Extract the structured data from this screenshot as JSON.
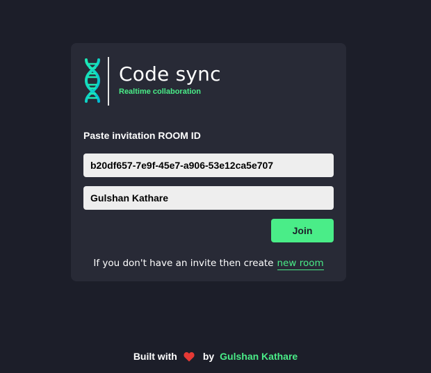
{
  "brand": {
    "title": "Code sync",
    "subtitle": "Realtime collaboration",
    "logo_icon": "dna-icon",
    "accent_color": "#4aed88"
  },
  "form": {
    "label": "Paste invitation ROOM ID",
    "room_id_value": "b20df657-7e9f-45e7-a906-53e12ca5e707",
    "username_value": "Gulshan Kathare",
    "join_label": "Join"
  },
  "create_info": {
    "text": "If you don't have an invite then create",
    "link_label": "new room"
  },
  "footer": {
    "built_with": "Built with",
    "heart_icon": "heart-icon",
    "by": "by",
    "author": "Gulshan Kathare"
  }
}
